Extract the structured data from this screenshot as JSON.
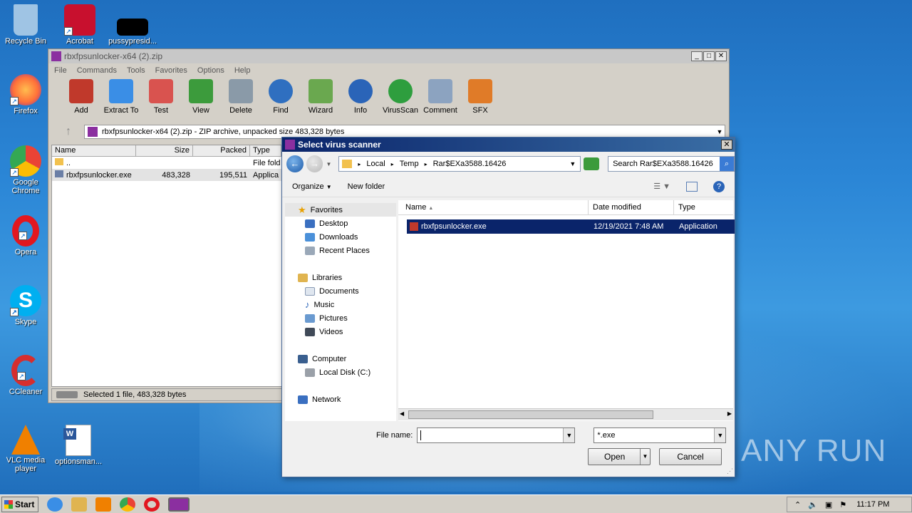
{
  "desktop": {
    "icons": [
      {
        "label": "Recycle Bin",
        "icon": "recycle-bin-icon",
        "color": "#9fc4e4"
      },
      {
        "label": "Acrobat",
        "icon": "acrobat-icon",
        "color": "#c8102e"
      },
      {
        "label": "pussypresid...",
        "icon": "file-icon",
        "color": "#000000"
      },
      {
        "label": "Firefox",
        "icon": "firefox-icon",
        "color": "#ff7139"
      },
      {
        "label": "Google Chrome",
        "icon": "chrome-icon",
        "color": "#34a853"
      },
      {
        "label": "Opera",
        "icon": "opera-icon",
        "color": "#e2171f"
      },
      {
        "label": "Skype",
        "icon": "skype-icon",
        "color": "#00aff0"
      },
      {
        "label": "CCleaner",
        "icon": "ccleaner-icon",
        "color": "#d62e2e"
      },
      {
        "label": "VLC media player",
        "icon": "vlc-icon",
        "color": "#f08000"
      },
      {
        "label": "optionsman...",
        "icon": "word-doc-icon",
        "color": "#2b579a"
      }
    ],
    "watermark": "ANY RUN"
  },
  "winrar": {
    "title": "rbxfpsunlocker-x64 (2).zip",
    "menu": [
      "File",
      "Commands",
      "Tools",
      "Favorites",
      "Options",
      "Help"
    ],
    "toolbar": [
      {
        "label": "Add",
        "icon": "add-archive-icon",
        "color": "#c0392b"
      },
      {
        "label": "Extract To",
        "icon": "folder-extract-icon",
        "color": "#3a8ee6"
      },
      {
        "label": "Test",
        "icon": "test-icon",
        "color": "#d9534f"
      },
      {
        "label": "View",
        "icon": "book-view-icon",
        "color": "#3c9b3c"
      },
      {
        "label": "Delete",
        "icon": "trash-icon",
        "color": "#8a9aa8"
      },
      {
        "label": "Find",
        "icon": "magnifier-icon",
        "color": "#2f6fc0"
      },
      {
        "label": "Wizard",
        "icon": "wand-icon",
        "color": "#6aa84f"
      },
      {
        "label": "Info",
        "icon": "info-icon",
        "color": "#2a64b8"
      },
      {
        "label": "VirusScan",
        "icon": "virus-scan-icon",
        "color": "#2e9e3e"
      },
      {
        "label": "Comment",
        "icon": "comment-icon",
        "color": "#8ca3c0"
      },
      {
        "label": "SFX",
        "icon": "sfx-icon",
        "color": "#e07b28"
      }
    ],
    "address": "rbxfpsunlocker-x64 (2).zip - ZIP archive, unpacked size 483,328 bytes",
    "columns": [
      "Name",
      "Size",
      "Packed",
      "Type"
    ],
    "rows": [
      {
        "name": "..",
        "size": "",
        "packed": "",
        "type": "File fold"
      },
      {
        "name": "rbxfpsunlocker.exe",
        "size": "483,328",
        "packed": "195,511",
        "type": "Applica"
      }
    ],
    "status": "Selected 1 file, 483,328 bytes"
  },
  "dialog": {
    "title": "Select virus scanner",
    "breadcrumb": [
      "Local",
      "Temp",
      "Rar$EXa3588.16426"
    ],
    "search_placeholder": "Search Rar$EXa3588.16426",
    "organize": "Organize",
    "new_folder": "New folder",
    "nav": {
      "favorites": "Favorites",
      "favorites_items": [
        "Desktop",
        "Downloads",
        "Recent Places"
      ],
      "libraries": "Libraries",
      "libraries_items": [
        "Documents",
        "Music",
        "Pictures",
        "Videos"
      ],
      "computer": "Computer",
      "computer_items": [
        "Local Disk (C:)"
      ],
      "network": "Network"
    },
    "columns": [
      "Name",
      "Date modified",
      "Type"
    ],
    "file": {
      "name": "rbxfpsunlocker.exe",
      "date": "12/19/2021 7:48 AM",
      "type": "Application"
    },
    "file_name_label": "File name:",
    "file_name_value": "",
    "filter": "*.exe",
    "open": "Open",
    "cancel": "Cancel"
  },
  "taskbar": {
    "start": "Start",
    "clock": "11:17 PM"
  }
}
